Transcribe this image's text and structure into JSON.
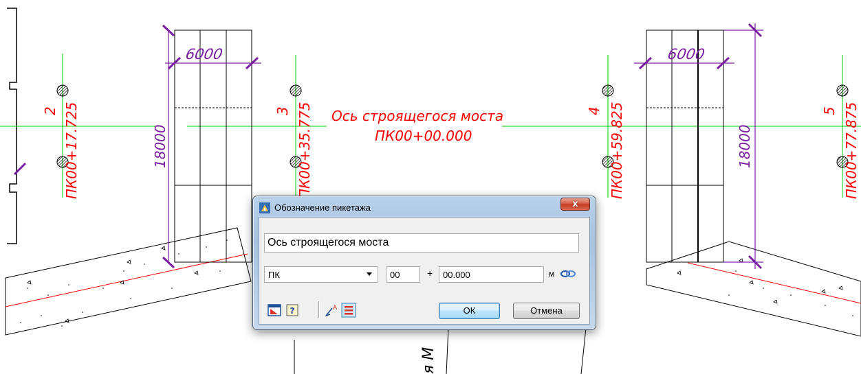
{
  "drawing": {
    "axis_label": "Ось строящегося моста",
    "axis_station": "ПК00+00.000",
    "dimensions": {
      "top_left": "6000",
      "top_right": "6000",
      "height_left": "18000",
      "height_right": "18000"
    },
    "axis_numbers": [
      "2",
      "3",
      "4",
      "5"
    ],
    "stations": [
      "ПК00+17.725",
      "ПК00+35.775",
      "ПК00+59.825",
      "ПК00+77.875"
    ],
    "bottom_text": "я М",
    "colors": {
      "axis": "#00cc00",
      "station_text": "#ff0000",
      "dimension": "#7a1fa2",
      "geometry": "#000000"
    }
  },
  "dialog": {
    "title": "Обозначение пикетажа",
    "close_label": "x",
    "name_value": "Ось строящегося моста",
    "prefix_value": "ПК",
    "km_value": "00",
    "plus": "+",
    "meters_value": "00.000",
    "unit": "м",
    "ok_label": "ОК",
    "cancel_label": "Отмена",
    "icons": [
      "app-icon",
      "close-icon",
      "dropdown-arrow-icon",
      "link-icon",
      "settings-icon",
      "help-icon",
      "text-style-icon",
      "alignment-icon"
    ]
  }
}
